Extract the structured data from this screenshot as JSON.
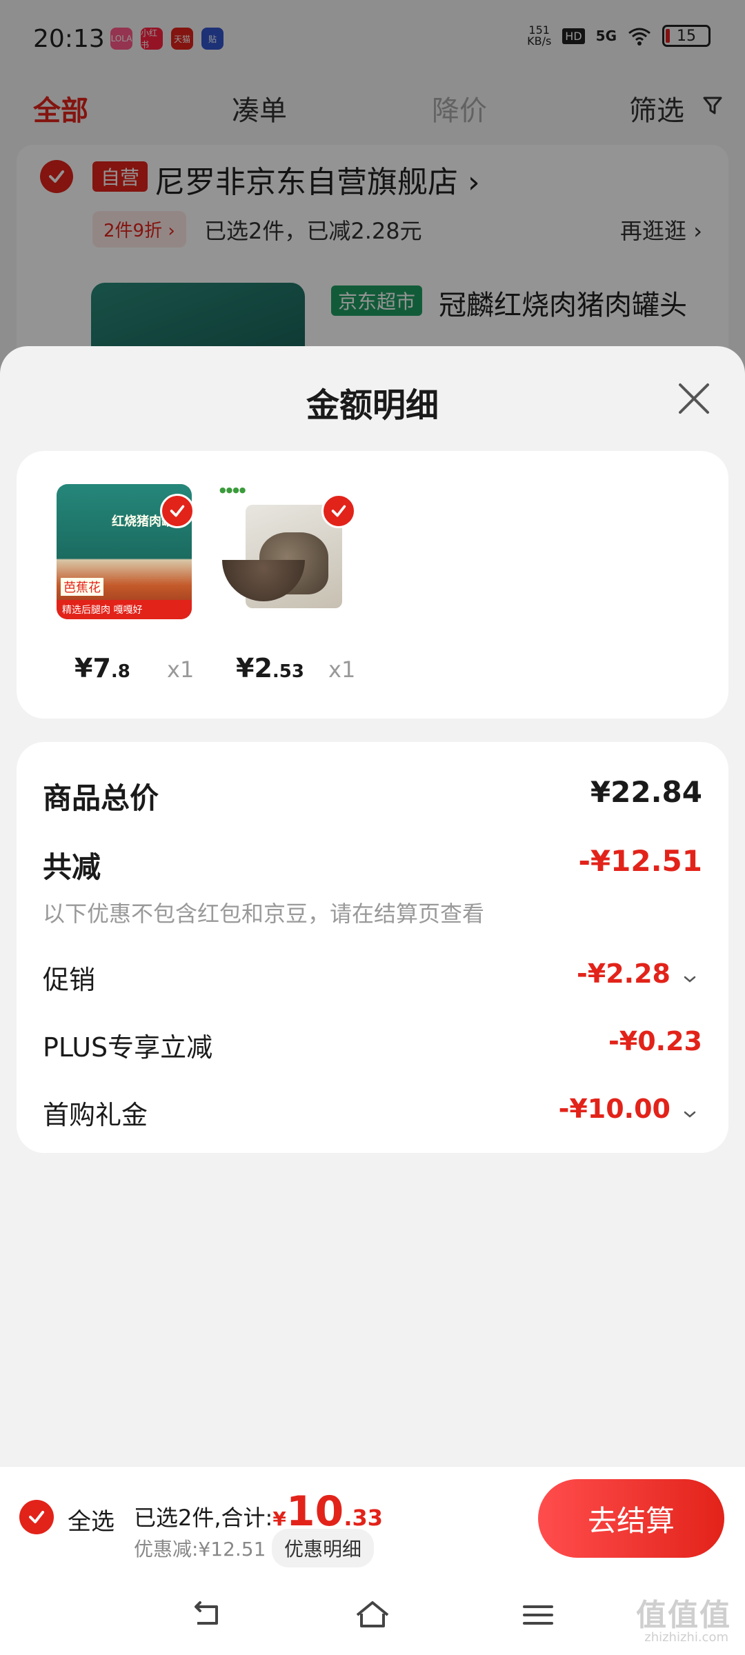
{
  "status_bar": {
    "time": "20:13",
    "apps": [
      {
        "label": "LOLA",
        "color": "#ff5a8a"
      },
      {
        "label": "小红书",
        "color": "#ff2442"
      },
      {
        "label": "天猫",
        "color": "#e2231a"
      },
      {
        "label": "贴",
        "color": "#3355cc"
      }
    ],
    "speed": "151\nKB/s",
    "network": "5G",
    "battery": "15"
  },
  "cart_tabs": {
    "all": "全部",
    "coudan": "凑单",
    "price_drop": "降价",
    "filter": "筛选"
  },
  "store": {
    "self_tag": "自营",
    "name": "尼罗非京东自营旗舰店 ›",
    "promo_tag": "2件9折 ›",
    "promo_text": "已选2件，已减2.28元",
    "more": "再逛逛 ›",
    "product_tag": "京东超市",
    "product_title": "冠麟红烧肉猪肉罐头"
  },
  "sheet": {
    "title": "金额明细",
    "items": [
      {
        "price_int": "¥7",
        "price_dec": ".8",
        "qty": "x1",
        "image": "canned-pork-image",
        "can_label": "红烧猪肉罐头",
        "can_strip": "精选后腿肉 嘎嘎好",
        "can_brand": "芭蕉花"
      },
      {
        "price_int": "¥2",
        "price_dec": ".53",
        "qty": "x1",
        "image": "dried-mushroom-image"
      }
    ],
    "rows": {
      "total_label": "商品总价",
      "total_value": "¥22.84",
      "reduce_label": "共减",
      "reduce_value": "-¥12.51",
      "reduce_note": "以下优惠不包含红包和京豆，请在结算页查看",
      "promo_label": "促销",
      "promo_value": "-¥2.28",
      "plus_label": "PLUS专享立减",
      "plus_value": "-¥0.23",
      "first_label": "首购礼金",
      "first_value": "-¥10.00"
    }
  },
  "bottom_bar": {
    "select_all": "全选",
    "total_prefix": "已选2件,合计:",
    "total_yen": "¥",
    "total_int": "10",
    "total_dec": ".33",
    "discount": "优惠减:¥12.51",
    "detail_btn": "优惠明细",
    "checkout": "去结算"
  },
  "watermark": {
    "main": "值值值",
    "sub": "zhizhizhi.com"
  },
  "colors": {
    "accent": "#e2231a",
    "jd_super": "#1f9e62",
    "muted": "#999999"
  }
}
